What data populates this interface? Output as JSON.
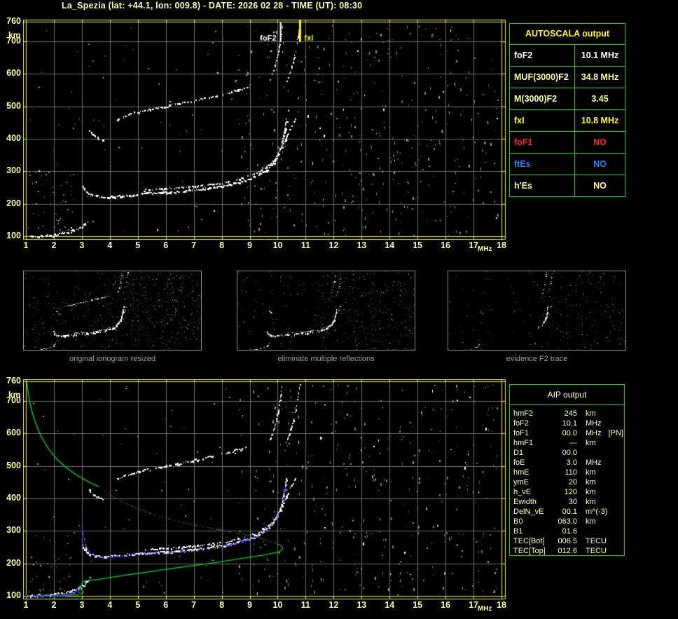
{
  "title": "La_Spezia (lat: +44.1, lon: 009.8) - DATE: 2026 02 28 - TIME (UT): 08:30",
  "colors": {
    "frame": "#f0f028",
    "grid": "#6f6f6f",
    "tick_label": "#ffff94",
    "table_border": "#00d800",
    "profile_green": "#00cc33",
    "fitted_blue": "#3a3aff",
    "marker_foF2": "#ffffff",
    "marker_fxI": "#ffee00",
    "caption_gray": "#9c9c9c"
  },
  "autoscala_table": {
    "header": "AUTOSCALA output",
    "rows": [
      {
        "label": "foF2",
        "value": "10.1 MHz",
        "color": "#ffffff"
      },
      {
        "label": "MUF(3000)F2",
        "value": "34.8 MHz",
        "color": "#ffff8c"
      },
      {
        "label": "M(3000)F2",
        "value": "3.45",
        "color": "#ffff8c"
      },
      {
        "label": "fxI",
        "value": "10.8 MHz",
        "color": "#ffff00"
      },
      {
        "label": "foF1",
        "value": "NO",
        "color": "#ff2020"
      },
      {
        "label": "ftEs",
        "value": "NO",
        "color": "#2080ff"
      },
      {
        "label": "h'Es",
        "value": "NO",
        "color": "#ffff8c"
      }
    ]
  },
  "thumbnails": [
    {
      "caption": "original ionogram resized"
    },
    {
      "caption": "eliminate multiple reflections"
    },
    {
      "caption": "evidence F2 trace"
    }
  ],
  "aip_table": {
    "header": "AIP output",
    "rows": [
      {
        "name": "hmF2",
        "value": "245",
        "unit": "km",
        "extra": ""
      },
      {
        "name": "foF2",
        "value": "10.1",
        "unit": "MHz",
        "extra": ""
      },
      {
        "name": "foF1",
        "value": "00.0",
        "unit": "MHz",
        "extra": "[PN]"
      },
      {
        "name": "hmF1",
        "value": "---",
        "unit": "km",
        "extra": ""
      },
      {
        "name": "D1",
        "value": "00.0",
        "unit": "",
        "extra": ""
      },
      {
        "name": "foE",
        "value": "3.0",
        "unit": "MHz",
        "extra": ""
      },
      {
        "name": "hmE",
        "value": "110",
        "unit": "km",
        "extra": ""
      },
      {
        "name": "ymE",
        "value": "20",
        "unit": "km",
        "extra": ""
      },
      {
        "name": "h_vE",
        "value": "120",
        "unit": "km",
        "extra": ""
      },
      {
        "name": "Ewidth",
        "value": "30",
        "unit": "km",
        "extra": ""
      },
      {
        "name": "DelN_vE",
        "value": "00.1",
        "unit": "m^(-3)",
        "extra": ""
      },
      {
        "name": "B0",
        "value": "063.0",
        "unit": "km",
        "extra": ""
      },
      {
        "name": "B1",
        "value": "01.6",
        "unit": "",
        "extra": ""
      },
      {
        "name": "TEC[Bot]",
        "value": "006.5",
        "unit": "TECU",
        "extra": ""
      },
      {
        "name": "TEC[Top]",
        "value": "012.6",
        "unit": "TECU",
        "extra": ""
      }
    ]
  },
  "chart_data": [
    {
      "id": "main_ionogram",
      "type": "scatter",
      "title": "autoscaled ionogram",
      "xlabel": "MHz",
      "ylabel": "km",
      "xlim": [
        1,
        18
      ],
      "ylim": [
        100,
        760
      ],
      "x_ticks": [
        1,
        2,
        3,
        4,
        5,
        6,
        7,
        8,
        9,
        10,
        11,
        12,
        13,
        14,
        15,
        16,
        17,
        18
      ],
      "y_ticks": [
        760,
        700,
        600,
        500,
        400,
        300,
        200,
        100
      ],
      "grid": true,
      "markers": [
        {
          "label": "foF2",
          "freq": 10.1,
          "color": "#ffffff"
        },
        {
          "label": "fxI",
          "freq": 10.8,
          "color": "#ffee00"
        }
      ],
      "series": {
        "e_trace": [
          [
            1.15,
            100
          ],
          [
            1.4,
            102
          ],
          [
            1.7,
            104
          ],
          [
            2.0,
            107
          ],
          [
            2.3,
            111
          ],
          [
            2.6,
            117
          ],
          [
            2.85,
            124
          ],
          [
            3.0,
            131
          ],
          [
            3.1,
            139
          ],
          [
            3.2,
            148
          ],
          [
            3.28,
            157
          ]
        ],
        "f_trace": [
          [
            3.02,
            258
          ],
          [
            3.08,
            246
          ],
          [
            3.18,
            236
          ],
          [
            3.3,
            229
          ],
          [
            3.5,
            224
          ],
          [
            3.8,
            222
          ],
          [
            4.2,
            224
          ],
          [
            4.8,
            229
          ],
          [
            5.4,
            233
          ],
          [
            6.0,
            237
          ],
          [
            6.6,
            241
          ],
          [
            7.2,
            246
          ],
          [
            7.8,
            253
          ],
          [
            8.4,
            263
          ],
          [
            8.9,
            275
          ],
          [
            9.3,
            290
          ],
          [
            9.6,
            307
          ],
          [
            9.85,
            328
          ],
          [
            10.0,
            352
          ],
          [
            10.12,
            382
          ],
          [
            10.2,
            412
          ],
          [
            10.26,
            442
          ],
          [
            10.3,
            465
          ]
        ],
        "f_xmode": [
          [
            5.2,
            243
          ],
          [
            6.0,
            248
          ],
          [
            6.8,
            253
          ],
          [
            7.6,
            260
          ],
          [
            8.2,
            269
          ],
          [
            8.8,
            282
          ],
          [
            9.3,
            298
          ],
          [
            9.7,
            320
          ],
          [
            9.95,
            347
          ],
          [
            10.15,
            380
          ],
          [
            10.35,
            414
          ],
          [
            10.5,
            442
          ],
          [
            10.62,
            462
          ]
        ],
        "hop_fragment": [
          [
            3.25,
            428
          ],
          [
            3.4,
            413
          ],
          [
            3.55,
            404
          ],
          [
            3.72,
            398
          ]
        ],
        "hop_mid": [
          [
            4.25,
            463
          ],
          [
            4.7,
            477
          ],
          [
            5.2,
            488
          ],
          [
            5.8,
            498
          ],
          [
            6.4,
            508
          ],
          [
            7.0,
            519
          ],
          [
            7.6,
            530
          ],
          [
            8.1,
            541
          ],
          [
            8.55,
            551
          ],
          [
            8.95,
            561
          ]
        ],
        "hop_asym1": [
          [
            9.72,
            582
          ],
          [
            9.9,
            628
          ],
          [
            10.02,
            672
          ],
          [
            10.1,
            716
          ],
          [
            10.15,
            756
          ]
        ],
        "hop_asym2": [
          [
            10.3,
            575
          ],
          [
            10.5,
            625
          ],
          [
            10.63,
            672
          ],
          [
            10.72,
            718
          ],
          [
            10.78,
            753
          ]
        ]
      }
    },
    {
      "id": "profile_fit_ionogram",
      "type": "scatter",
      "title": "restored ionogram with electron density profile and fitted trace",
      "xlabel": "MHz",
      "ylabel": "km",
      "xlim": [
        1,
        18
      ],
      "ylim": [
        100,
        760
      ],
      "x_ticks": [
        1,
        2,
        3,
        4,
        5,
        6,
        7,
        8,
        9,
        10,
        11,
        12,
        13,
        14,
        15,
        16,
        17,
        18
      ],
      "y_ticks": [
        760,
        700,
        600,
        500,
        400,
        300,
        200,
        100
      ],
      "grid": true,
      "peak": {
        "foF2_MHz": 10.1,
        "hmF2_km": 245
      },
      "profile_green": {
        "solid1": [
          [
            1.03,
            758
          ],
          [
            1.1,
            715
          ],
          [
            1.2,
            672
          ],
          [
            1.35,
            630
          ],
          [
            1.55,
            590
          ],
          [
            1.8,
            553
          ],
          [
            2.1,
            521
          ],
          [
            2.45,
            494
          ],
          [
            2.85,
            470
          ],
          [
            3.3,
            448
          ],
          [
            3.6,
            436
          ]
        ],
        "dotted": [
          [
            3.6,
            436
          ],
          [
            4.0,
            412
          ],
          [
            4.4,
            392
          ],
          [
            4.9,
            372
          ],
          [
            5.4,
            356
          ],
          [
            6.0,
            340
          ],
          [
            6.6,
            327
          ],
          [
            7.2,
            316
          ],
          [
            7.8,
            306
          ],
          [
            8.4,
            296
          ],
          [
            9.0,
            286
          ],
          [
            9.5,
            276
          ],
          [
            9.9,
            265
          ],
          [
            10.1,
            256
          ]
        ],
        "solid2": [
          [
            10.1,
            256
          ],
          [
            10.18,
            248
          ],
          [
            10.14,
            240
          ],
          [
            10.0,
            234
          ],
          [
            9.6,
            227
          ],
          [
            9.0,
            219
          ],
          [
            8.2,
            208
          ],
          [
            7.4,
            198
          ],
          [
            6.6,
            189
          ],
          [
            5.8,
            179
          ],
          [
            5.0,
            169
          ],
          [
            4.2,
            159
          ],
          [
            3.6,
            151
          ],
          [
            3.15,
            146
          ],
          [
            3.08,
            146
          ]
        ],
        "loop": [
          [
            3.08,
            146
          ],
          [
            2.98,
            134
          ],
          [
            2.9,
            122
          ],
          [
            2.88,
            112
          ],
          [
            2.94,
            106
          ],
          [
            3.02,
            106
          ],
          [
            3.05,
            112
          ],
          [
            3.0,
            119
          ],
          [
            2.92,
            120
          ],
          [
            2.88,
            112
          ]
        ],
        "bottom_line": [
          [
            2.9,
            103
          ],
          [
            2.3,
            102
          ],
          [
            1.8,
            102
          ],
          [
            1.4,
            102
          ]
        ]
      },
      "fitted_blue": {
        "base": [
          [
            1.0,
            102
          ],
          [
            2.3,
            102
          ]
        ],
        "e_rise": [
          [
            2.35,
            104
          ],
          [
            2.55,
            109
          ],
          [
            2.75,
            115
          ],
          [
            2.9,
            122
          ],
          [
            3.0,
            130
          ]
        ],
        "cusp": [
          [
            3.0,
            314
          ],
          [
            3.04,
            293
          ],
          [
            3.08,
            272
          ],
          [
            3.14,
            253
          ],
          [
            3.22,
            240
          ],
          [
            3.33,
            230
          ],
          [
            3.52,
            223
          ],
          [
            3.72,
            220
          ]
        ],
        "f_fit": [
          [
            3.72,
            220
          ],
          [
            4.1,
            222
          ],
          [
            4.7,
            227
          ],
          [
            5.3,
            231
          ],
          [
            5.9,
            235
          ],
          [
            6.5,
            239
          ],
          [
            7.1,
            244
          ],
          [
            7.7,
            250
          ],
          [
            8.3,
            259
          ],
          [
            8.8,
            271
          ],
          [
            9.2,
            285
          ],
          [
            9.55,
            302
          ],
          [
            9.8,
            322
          ],
          [
            9.98,
            347
          ],
          [
            10.1,
            375
          ],
          [
            10.18,
            402
          ],
          [
            10.24,
            425
          ],
          [
            10.28,
            440
          ]
        ]
      }
    }
  ]
}
